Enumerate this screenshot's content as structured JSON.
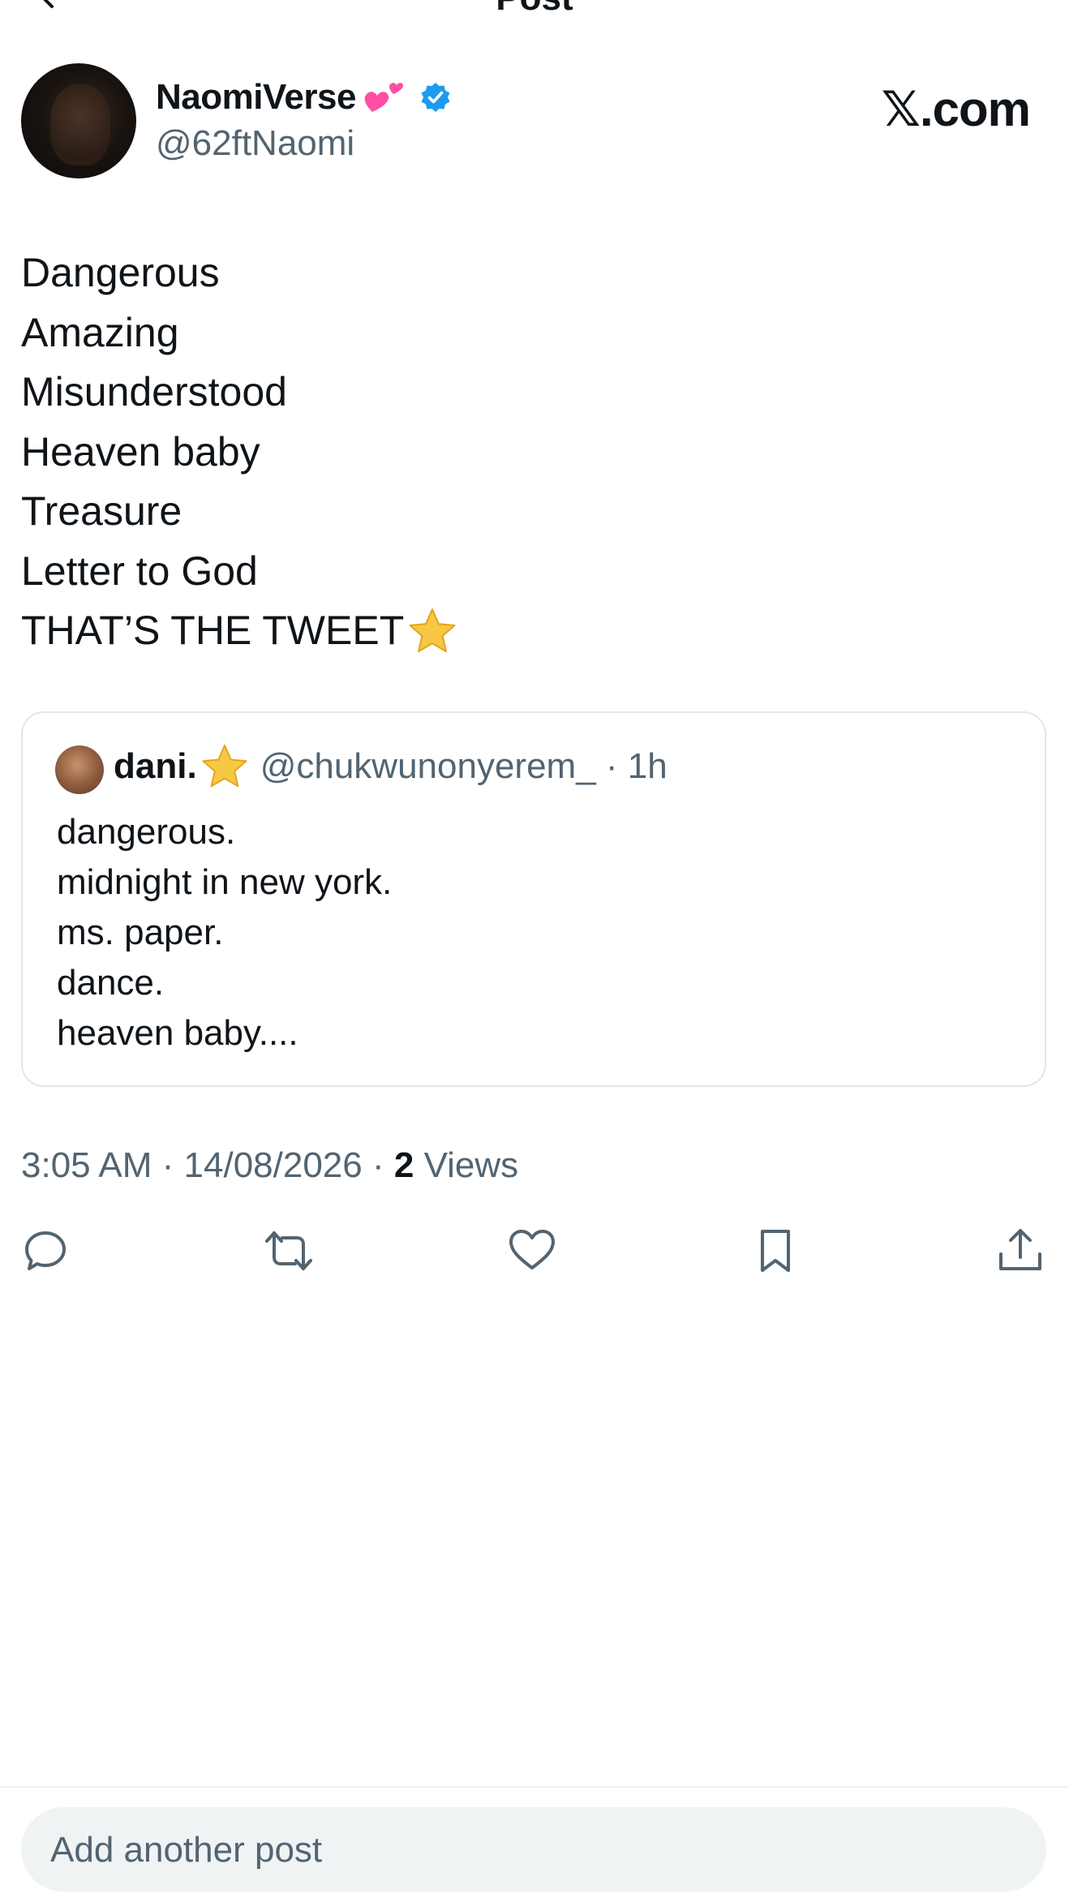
{
  "header": {
    "title": "Post"
  },
  "author": {
    "display_name": "NaomiVerse",
    "handle": "@62ftNaomi",
    "verified": true
  },
  "brand": "𝕏.com",
  "tweet_lines": [
    "Dangerous",
    "Amazing",
    "Misunderstood",
    "Heaven baby",
    "Treasure",
    "Letter to God",
    "THAT’S THE TWEET"
  ],
  "quote": {
    "name": "dani.",
    "handle_time": "@chukwunonyerem_ · 1h",
    "lines": [
      "dangerous.",
      "midnight in new york.",
      "ms. paper.",
      "dance.",
      "heaven baby...."
    ]
  },
  "meta": {
    "time_date": "3:05 AM · 14/08/2026 · ",
    "views_count": "2",
    "views_label": " Views"
  },
  "composer": {
    "placeholder": "Add another post"
  },
  "colors": {
    "verified": "#1d9bf0",
    "secondary_text": "#536471",
    "star": "#f7c844",
    "heart_emoji": "#ff4fa3"
  }
}
